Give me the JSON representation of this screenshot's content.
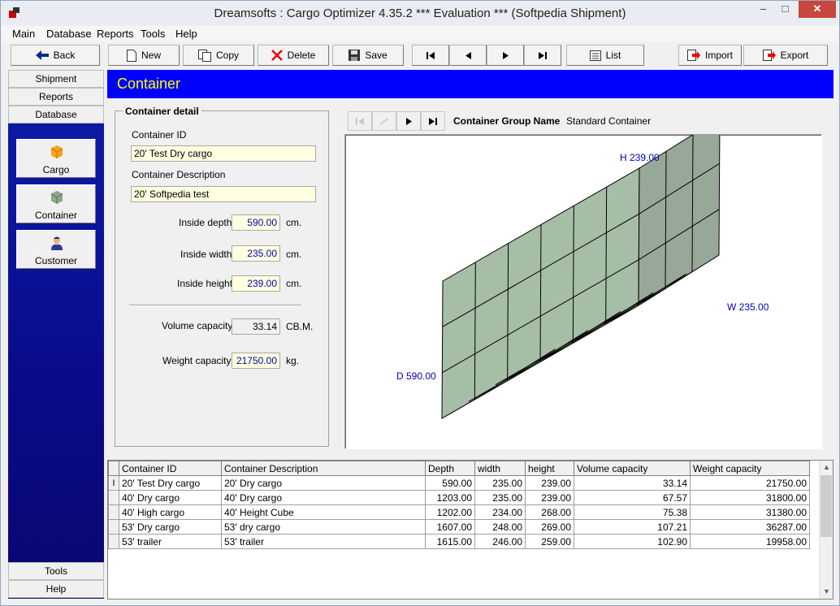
{
  "window": {
    "title": "Dreamsofts : Cargo Optimizer 4.35.2 *** Evaluation *** (Softpedia Shipment)"
  },
  "menu": [
    "Main",
    "Database",
    "Reports",
    "Tools",
    "Help"
  ],
  "toolbar": {
    "back": "Back",
    "new": "New",
    "copy": "Copy",
    "delete": "Delete",
    "save": "Save",
    "list": "List",
    "import": "Import",
    "export": "Export"
  },
  "leftnav": {
    "tabs_top": [
      "Shipment",
      "Reports",
      "Database"
    ],
    "cards": [
      "Cargo",
      "Container",
      "Customer"
    ],
    "tabs_bottom": [
      "Tools",
      "Help"
    ]
  },
  "header": {
    "title": "Container"
  },
  "detail": {
    "group_title": "Container detail",
    "id_label": "Container ID",
    "id_value": "20' Test Dry cargo",
    "desc_label": "Container Description",
    "desc_value": "20' Softpedia test",
    "depth_label": "Inside depth",
    "depth_value": "590.00",
    "depth_unit": "cm.",
    "width_label": "Inside width",
    "width_value": "235.00",
    "width_unit": "cm.",
    "height_label": "Inside height",
    "height_value": "239.00",
    "height_unit": "cm.",
    "volume_label": "Volume capacity",
    "volume_value": "33.14",
    "volume_unit": "CB.M.",
    "weight_label": "Weight capacity",
    "weight_value": "21750.00",
    "weight_unit": "kg."
  },
  "group": {
    "label": "Container Group Name",
    "value": "Standard Container"
  },
  "view3d": {
    "h_label": "H 239.00",
    "w_label": "W 235.00",
    "d_label": "D 590.00"
  },
  "grid": {
    "columns": [
      "Container ID",
      "Container Description",
      "Depth",
      "width",
      "height",
      "Volume capacity",
      "Weight capacity"
    ],
    "rows": [
      [
        "20' Test Dry cargo",
        "20' Dry cargo",
        "590.00",
        "235.00",
        "239.00",
        "33.14",
        "21750.00"
      ],
      [
        "40' Dry cargo",
        "40' Dry cargo",
        "1203.00",
        "235.00",
        "239.00",
        "67.57",
        "31800.00"
      ],
      [
        "40' High cargo",
        "40' Height Cube",
        "1202.00",
        "234.00",
        "268.00",
        "75.38",
        "31380.00"
      ],
      [
        "53' Dry cargo",
        "53' dry cargo",
        "1607.00",
        "248.00",
        "269.00",
        "107.21",
        "36287.00"
      ],
      [
        "53' trailer",
        "53' trailer",
        "1615.00",
        "246.00",
        "259.00",
        "102.90",
        "19958.00"
      ]
    ]
  },
  "colors": {
    "accent_header": "#0000ff",
    "header_text": "#ffff00",
    "box_wall": "#a6bda6",
    "box_floor": "#9a9a9a"
  }
}
